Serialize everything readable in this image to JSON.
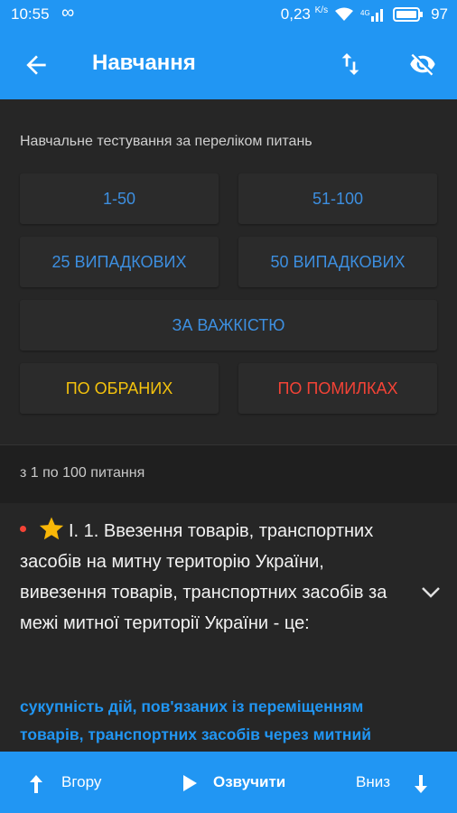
{
  "status": {
    "time": "10:55",
    "infinity": "∞",
    "speed": "0,23",
    "speed_unit": "K/s",
    "battery": "97"
  },
  "appbar": {
    "title": "Навчання"
  },
  "panel": {
    "subtitle": "Навчальне тестування за переліком питань",
    "buttons": {
      "range1": "1-50",
      "range2": "51-100",
      "random25": "25 ВИПАДКОВИХ",
      "random50": "50 ВИПАДКОВИХ",
      "difficulty": "ЗА ВАЖКІСТЮ",
      "favorites": "ПО ОБРАНИХ",
      "mistakes": "ПО ПОМИЛКАХ"
    }
  },
  "range_label": "з 1 по 100 питання",
  "question": {
    "text": "І. 1. Ввезення товарів, транспортних засобів на митну територію України, вивезення товарів, транспортних засобів за межі митної території України - це:",
    "answer": "сукупність дій, пов'язаних із переміщенням товарів, транспортних засобів через митний"
  },
  "bottombar": {
    "up": "Вгору",
    "speak": "Озвучити",
    "down": "Вниз"
  },
  "colors": {
    "primary": "#2196f3",
    "favorites": "#f4c20d",
    "mistakes": "#f44336",
    "button_text": "#3d8fe0"
  }
}
